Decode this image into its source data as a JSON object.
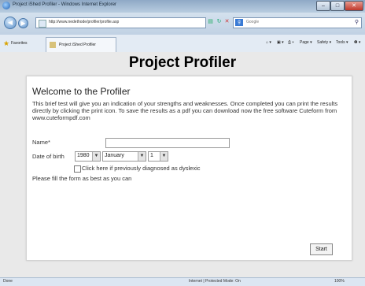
{
  "window": {
    "title": "Project iShed Profiler - Windows Internet Explorer",
    "minimize": "–",
    "maximize": "□",
    "close": "✕"
  },
  "addressbar": {
    "url": "http://www.nedethode/profiler/profile.asp",
    "search_placeholder": "Google",
    "search_icon": "magnifier-icon"
  },
  "favorites": {
    "label": "Favorites",
    "tab_title": "Project iShed Profiler",
    "toolbar": [
      "Page ▾",
      "Safety ▾",
      "Tools ▾",
      "❷ ▾"
    ]
  },
  "page": {
    "title": "Project Profiler",
    "heading": "Welcome to the Profiler",
    "intro": "This brief test will give you an indication of your strengths and weaknesses. Once completed you can print the results directly by clicking the print icon. To save the results as a pdf you can download now the free software Cuteform from www.cuteformpdf.com",
    "name_label": "Name*",
    "name_value": "",
    "dob_label": "Date of birth",
    "year": "1980",
    "month": "January",
    "day": "1",
    "dyslexia_label": "Click here if previously diagnosed as dyslexic",
    "fill_label": "Please fill the form as best as you can",
    "start_label": "Start"
  },
  "status": {
    "left": "Done",
    "zone": "Internet | Protected Mode: On",
    "zoom": "100%"
  }
}
